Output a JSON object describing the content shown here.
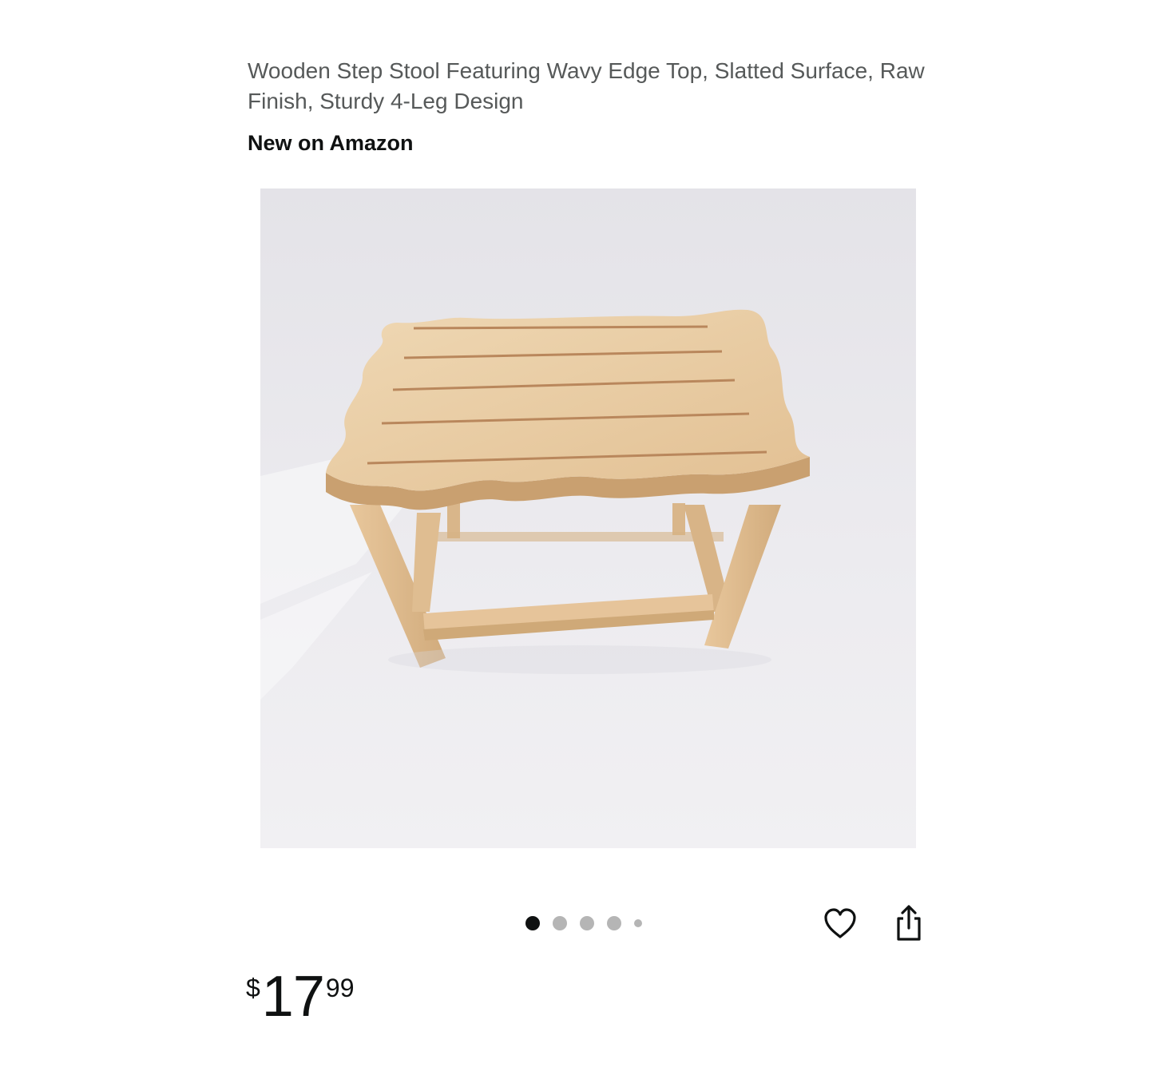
{
  "product": {
    "title": "Wooden Step Stool Featuring Wavy Edge Top, Slatted Surface, Raw Finish, Sturdy 4-Leg Design",
    "badge": "New on Amazon",
    "price": {
      "symbol": "$",
      "whole": "17",
      "fraction": "99"
    }
  },
  "gallery": {
    "image_subject": "wooden step stool product photo",
    "dot_count": 5,
    "active_index": 0
  },
  "actions": {
    "favorite_icon": "heart-icon",
    "share_icon": "share-icon"
  },
  "colors": {
    "text_primary": "#0f1111",
    "text_secondary": "#565959",
    "dot_active": "#0f1111",
    "dot_inactive": "#b5b5b5"
  }
}
